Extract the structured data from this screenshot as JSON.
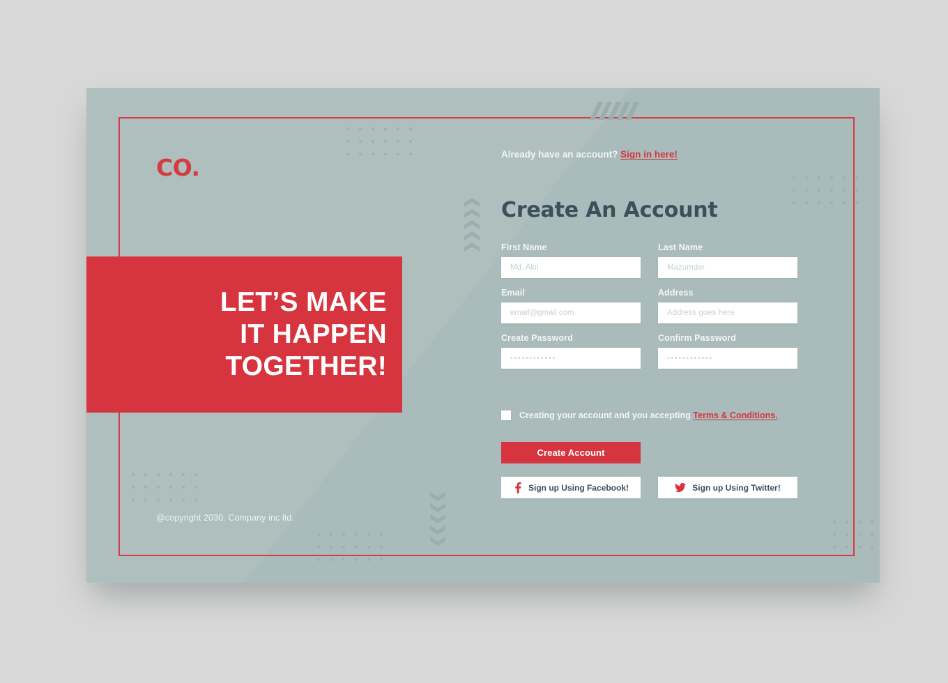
{
  "colors": {
    "page_background": "#d8d8d8",
    "card_background": "#a9bbba",
    "accent_red": "#d6353f",
    "frame_red": "#d63b42",
    "heading_navy": "#3d4e5c",
    "input_white": "#ffffff",
    "decor_gray": "#9aaead"
  },
  "brand": {
    "logo": "CO."
  },
  "banner": {
    "line1": "LET’S MAKE",
    "line2": "IT HAPPEN",
    "line3": "TOGETHER!"
  },
  "footer": {
    "copyright": "@copyright 2030. Company inc ltd."
  },
  "signin": {
    "prompt": "Already have an account?",
    "link_label": "Sign in here!"
  },
  "form": {
    "title": "Create An Account",
    "fields": [
      {
        "label": "First Name",
        "placeholder": "Md. Akil",
        "value": "",
        "type": "text"
      },
      {
        "label": "Last Name",
        "placeholder": "Mazumder",
        "value": "",
        "type": "text"
      },
      {
        "label": "Email",
        "placeholder": "email@gmail.com",
        "value": "",
        "type": "email"
      },
      {
        "label": "Address",
        "placeholder": "Address goes here",
        "value": "",
        "type": "text"
      },
      {
        "label": "Create Password",
        "placeholder": "••••••••••••",
        "value": "",
        "type": "password"
      },
      {
        "label": "Confirm Password",
        "placeholder": "••••••••••••",
        "value": "",
        "type": "password"
      }
    ],
    "terms": {
      "checked": false,
      "text": "Creating your account and you accepting",
      "link_label": "Terms & Conditions."
    },
    "submit_label": "Create Account",
    "social": [
      {
        "label": "Sign up Using Facebook!",
        "icon": "facebook-icon"
      },
      {
        "label": "Sign up Using Twitter!",
        "icon": "twitter-icon"
      }
    ]
  },
  "decor": {
    "chevron_up_count": 5,
    "chevron_down_count": 5,
    "slash_count": 5,
    "dot_grids": 5
  }
}
